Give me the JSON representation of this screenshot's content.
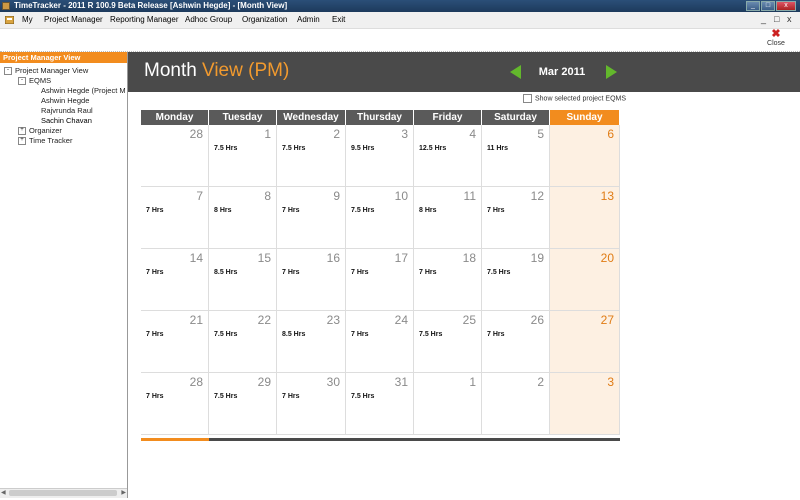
{
  "window": {
    "title": "TimeTracker - 2011 R 100.9 Beta Release  [Ashwin Hegde] - [Month View]",
    "controls": [
      "_",
      "□",
      "x"
    ]
  },
  "menu": {
    "items": [
      "My",
      "Project Manager",
      "Reporting Manager",
      "Adhoc Group",
      "Organization",
      "Admin",
      "Exit"
    ],
    "mdi_controls": [
      "_",
      "□",
      "x"
    ]
  },
  "toolbar": {
    "close_label": "Close"
  },
  "left_panel": {
    "header": "Project Manager View",
    "tree": [
      {
        "label": "Project Manager View",
        "expander": "-"
      },
      {
        "label": "EQMS",
        "expander": "-"
      },
      {
        "label": "Ashwin Hegde (Project M"
      },
      {
        "label": "Ashwin Hegde"
      },
      {
        "label": "Rajvrunda Raul"
      },
      {
        "label": "Sachin Chavan"
      },
      {
        "label": "Organizer",
        "expander": "+"
      },
      {
        "label": "Time Tracker",
        "expander": "+"
      }
    ]
  },
  "header": {
    "title_part1": "Month",
    "title_part2": "View (PM)",
    "month_label": "Mar 2011"
  },
  "show_selected_label": "Show selected project EQMS",
  "calendar": {
    "days": [
      "Monday",
      "Tuesday",
      "Wednesday",
      "Thursday",
      "Friday",
      "Saturday",
      "Sunday"
    ],
    "weeks": [
      [
        {
          "d": "28",
          "h": ""
        },
        {
          "d": "1",
          "h": "7.5 Hrs"
        },
        {
          "d": "2",
          "h": "7.5 Hrs"
        },
        {
          "d": "3",
          "h": "9.5 Hrs"
        },
        {
          "d": "4",
          "h": "12.5 Hrs"
        },
        {
          "d": "5",
          "h": "11 Hrs"
        },
        {
          "d": "6",
          "h": ""
        }
      ],
      [
        {
          "d": "7",
          "h": "7 Hrs"
        },
        {
          "d": "8",
          "h": "8 Hrs"
        },
        {
          "d": "9",
          "h": "7 Hrs"
        },
        {
          "d": "10",
          "h": "7.5 Hrs"
        },
        {
          "d": "11",
          "h": "8 Hrs"
        },
        {
          "d": "12",
          "h": "7 Hrs"
        },
        {
          "d": "13",
          "h": ""
        }
      ],
      [
        {
          "d": "14",
          "h": "7 Hrs"
        },
        {
          "d": "15",
          "h": "8.5 Hrs"
        },
        {
          "d": "16",
          "h": "7 Hrs"
        },
        {
          "d": "17",
          "h": "7 Hrs"
        },
        {
          "d": "18",
          "h": "7 Hrs"
        },
        {
          "d": "19",
          "h": "7.5 Hrs"
        },
        {
          "d": "20",
          "h": ""
        }
      ],
      [
        {
          "d": "21",
          "h": "7 Hrs"
        },
        {
          "d": "22",
          "h": "7.5 Hrs"
        },
        {
          "d": "23",
          "h": "8.5 Hrs"
        },
        {
          "d": "24",
          "h": "7 Hrs"
        },
        {
          "d": "25",
          "h": "7.5 Hrs"
        },
        {
          "d": "26",
          "h": "7 Hrs"
        },
        {
          "d": "27",
          "h": ""
        }
      ],
      [
        {
          "d": "28",
          "h": "7 Hrs"
        },
        {
          "d": "29",
          "h": "7.5 Hrs"
        },
        {
          "d": "30",
          "h": "7 Hrs"
        },
        {
          "d": "31",
          "h": "7.5 Hrs"
        },
        {
          "d": "1",
          "h": ""
        },
        {
          "d": "2",
          "h": ""
        },
        {
          "d": "3",
          "h": ""
        }
      ]
    ]
  },
  "colors": {
    "accent": "#f28c1e",
    "header_bg": "#4a4a4a",
    "nav_arrow": "#63b82c",
    "weekend_bg": "#fdf0e2"
  }
}
